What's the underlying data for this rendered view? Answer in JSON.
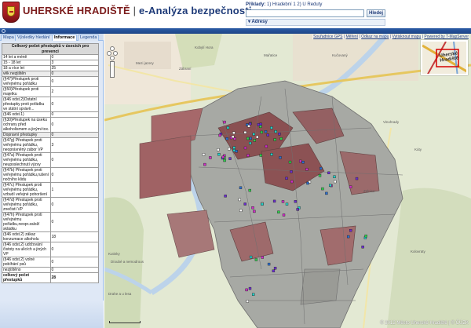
{
  "header": {
    "city": "UHERSKÉ HRADIŠTĚ",
    "separator": "|",
    "app_name": "e-Analýza bezpečnosti",
    "examples_label": "Příklady:",
    "examples_text": "1) Hradební  1  2) U Reduty",
    "search_value": "",
    "search_button": "Hledej",
    "address_label": "▾ Adresy"
  },
  "tabs": [
    {
      "label": "Mapa"
    },
    {
      "label": "Výsledky hledání"
    },
    {
      "label": "Informace"
    },
    {
      "label": "Legenda"
    }
  ],
  "stats_table": {
    "title": "Celkový počet přestupků v úsecích pro prevenci",
    "rows": [
      {
        "label": "14 let a méně",
        "value": "0"
      },
      {
        "label": "15 - 18 let",
        "value": "3"
      },
      {
        "label": "18 a více let",
        "value": "25"
      },
      {
        "label": "věk nezjištěn",
        "value": "0"
      },
      {
        "label": "(§47)Přestupek proti veřejnému pořádku",
        "value": "0"
      },
      {
        "label": "(§50)Přestupek proti majetku",
        "value": "2"
      },
      {
        "label": "(§46 odst.2)Ostatní přestupky proti pořádku ve státní správě...",
        "value": "0"
      },
      {
        "label": "(§46 odst.1)",
        "value": "0"
      },
      {
        "label": "(§30)Přestupek na úseku ochrany před alkoholismem a jinými tox.",
        "value": "0"
      },
      {
        "label": "Dopravní přestupky",
        "value": "0"
      },
      {
        "label": "(§47g) Přestupek proti veřejnému pořádku, neoprávněný zábor VP",
        "value": "3"
      },
      {
        "label": "(§47a) Přestupek proti veřejnému pořádku, neuposlechnutí výzvy",
        "value": "0"
      },
      {
        "label": "(§47b) Přestupek proti veřejnému pořádku,rušení nočního klidu",
        "value": "0"
      },
      {
        "label": "(§47c) Přestupek proti veřejnému pořádku, vzbudí veřejné pohoršení",
        "value": "1"
      },
      {
        "label": "(§47d) Přestupek proti veřejnému pořádku, znečistí VP",
        "value": "0"
      },
      {
        "label": "(§47h) Přestupek proti veřejnému pořádku,neopr.založí skládku",
        "value": "0"
      },
      {
        "label": "(§46 odst.2) zákaz konzumace alkoholu",
        "value": "18"
      },
      {
        "label": "(§46 odst.2) udržování čistoty na ulicích a jiných VP",
        "value": "0"
      },
      {
        "label": "(§46 odst.2) volné pobíhání psů",
        "value": "0"
      },
      {
        "label": "nezjištěno",
        "value": "0"
      }
    ],
    "total_label": "celkový počet přestupků",
    "total_value": "28"
  },
  "map": {
    "toplinks": [
      "Souřadnice GPS",
      "Měření",
      "Odkaz na mapu",
      "Vytisknout mapu",
      "Powered by T-MapServer"
    ],
    "overview_label": "Uherské\nHradiště",
    "copyright": "© 2012 Město Uherské Hradiště | © ČÚZK",
    "labels": [
      {
        "text": "Mařatice"
      },
      {
        "text": "Zábraní"
      },
      {
        "text": "Kučovaný"
      },
      {
        "text": "Mezi jazery"
      },
      {
        "text": "Vinohrady"
      },
      {
        "text": "Kúty"
      },
      {
        "text": "Kolovraty"
      },
      {
        "text": "Kutinky"
      },
      {
        "text": "Zelnice"
      },
      {
        "text": "Díoubé a nemodrous"
      },
      {
        "text": "Drahe a u lesa"
      },
      {
        "text": "Kobylí Hora"
      }
    ]
  },
  "colors": {
    "brand_red": "#7b1b1b",
    "brand_blue": "#1d3a78",
    "bar_blue": "#1e4688",
    "panel_bg": "#dfe8f6"
  }
}
